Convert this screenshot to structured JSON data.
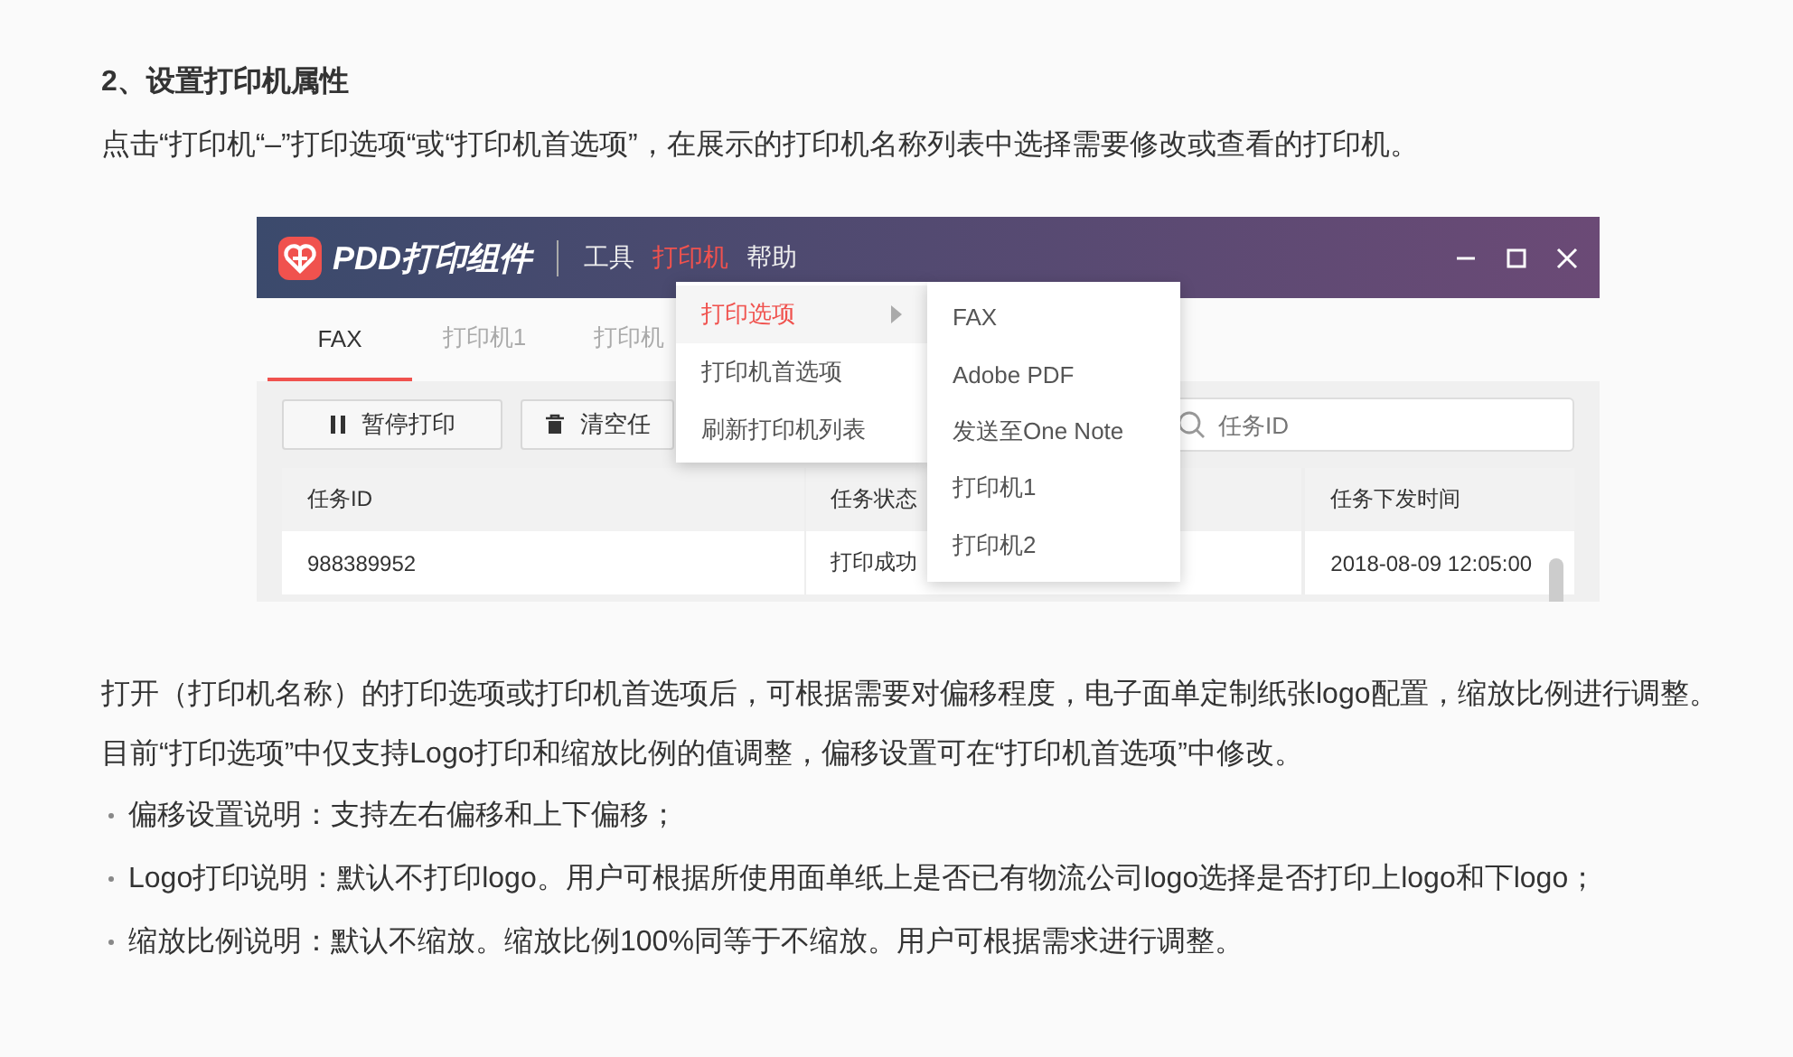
{
  "heading": "2、设置打印机属性",
  "intro": "点击“打印机“–”打印选项“或“打印机首选项”，在展示的打印机名称列表中选择需要修改或查看的打印机。",
  "screenshot": {
    "app_name": "PDD打印组件",
    "menubar": [
      {
        "label": "工具",
        "selected": false
      },
      {
        "label": "打印机",
        "selected": true
      },
      {
        "label": "帮助",
        "selected": false
      }
    ],
    "tabs": [
      {
        "label": "FAX",
        "selected": true
      },
      {
        "label": "打印机1",
        "selected": false
      },
      {
        "label": "打印机",
        "selected": false
      }
    ],
    "toolbar": [
      {
        "kind": "pause",
        "label": "暂停打印"
      },
      {
        "kind": "delete",
        "label": "清空任"
      }
    ],
    "search": {
      "placeholder": "任务ID"
    },
    "columns": [
      "任务ID",
      "任务状态",
      "任务下发时间"
    ],
    "rows": [
      [
        "988389952",
        "打印成功",
        "2018-08-09 12:05:00"
      ]
    ],
    "menu": [
      {
        "label": "打印选项",
        "selected": true,
        "has_submenu": true
      },
      {
        "label": "打印机首选项",
        "selected": false,
        "has_submenu": false
      },
      {
        "label": "刷新打印机列表",
        "selected": false,
        "has_submenu": false
      }
    ],
    "submenu": [
      "FAX",
      "Adobe PDF",
      "发送至One Note",
      "打印机1",
      "打印机2"
    ]
  },
  "paragraphs": [
    "打开（打印机名称）的打印选项或打印机首选项后，可根据需要对偏移程度，电子面单定制纸张logo配置，缩放比例进行调整。",
    "目前“打印选项”中仅支持Logo打印和缩放比例的值调整，偏移设置可在“打印机首选项”中修改。"
  ],
  "bullets": [
    "偏移设置说明：支持左右偏移和上下偏移；",
    "Logo打印说明：默认不打印logo。用户可根据所使用面单纸上是否已有物流公司logo选择是否打印上logo和下logo；",
    "缩放比例说明：默认不缩放。缩放比例100%同等于不缩放。用户可根据需求进行调整。"
  ]
}
